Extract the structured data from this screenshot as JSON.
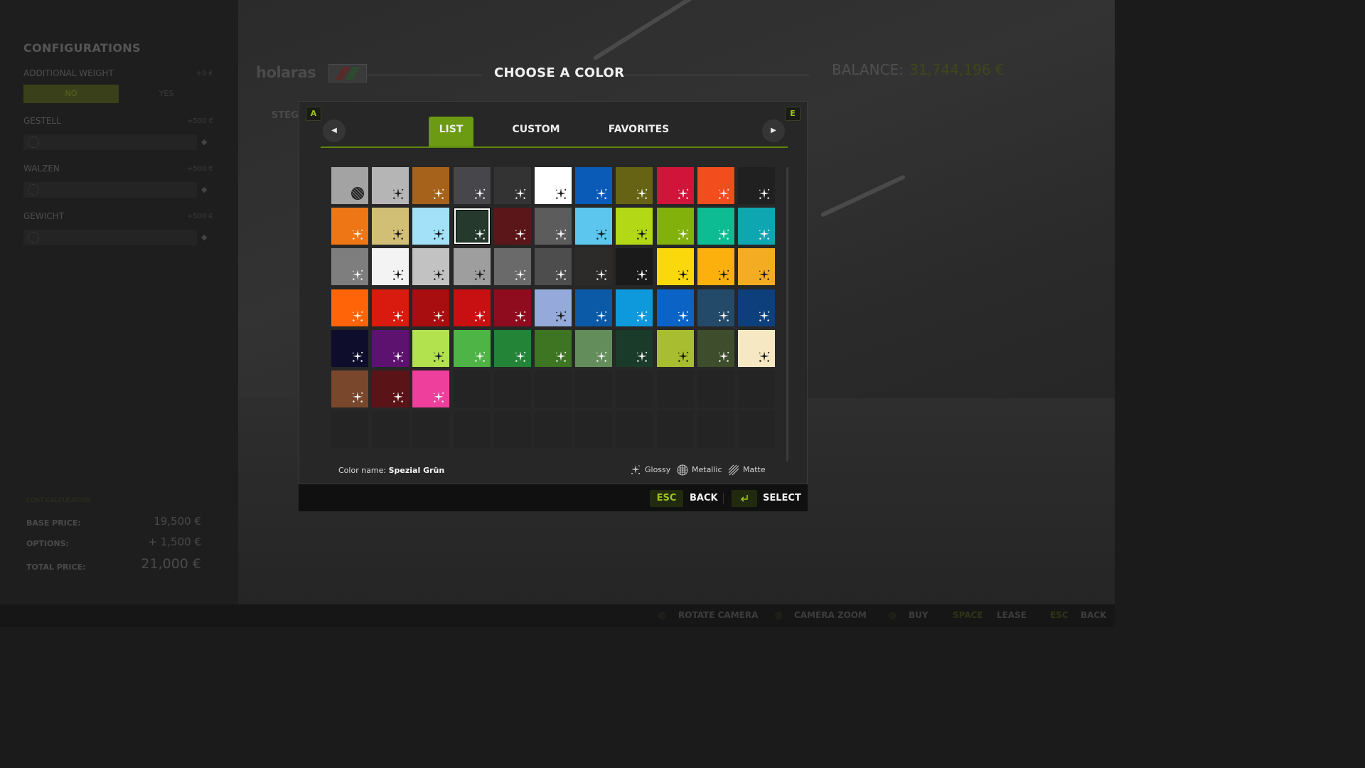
{
  "background": {
    "configurations": {
      "title": "CONFIGURATIONS",
      "additional_weight_label": "ADDITIONAL WEIGHT",
      "additional_weight_price": "+0 €",
      "no_label": "NO",
      "yes_label": "YES",
      "gestell_label": "GESTELL",
      "gestell_price": "+500 €",
      "walzen_label": "WALZEN",
      "walzen_price": "+500 €",
      "gewicht_label": "GEWICHT",
      "gewicht_price": "+500 €"
    },
    "cost": {
      "title": "COST CALCULATION",
      "base_price_label": "BASE PRICE:",
      "base_price": "19,500 €",
      "options_label": "OPTIONS:",
      "options": "+ 1,500 €",
      "total_label": "TOTAL PRICE:",
      "total": "21,000 €"
    },
    "brand": "holaras",
    "steg_label": "STEG",
    "balance_label": "BALANCE:",
    "balance_value": "31,744,196 €",
    "bottom_bar": {
      "rotate_camera": "ROTATE CAMERA",
      "camera_zoom": "CAMERA ZOOM",
      "buy": "BUY",
      "space_key": "SPACE",
      "lease": "LEASE",
      "esc_key": "ESC",
      "back": "BACK"
    }
  },
  "dialog": {
    "title": "CHOOSE A COLOR",
    "key_left": "A",
    "key_right": "E",
    "tabs": [
      {
        "label": "LIST",
        "active": true
      },
      {
        "label": "CUSTOM",
        "active": false
      },
      {
        "label": "FAVORITES",
        "active": false
      }
    ],
    "accent_color": "#6c9a12",
    "swatches": [
      {
        "color": "#a3a3a3",
        "finish": "metallic"
      },
      {
        "color": "#b5b5b5",
        "finish": "glossy"
      },
      {
        "color": "#a6621a",
        "finish": "glossy"
      },
      {
        "color": "#46464b",
        "finish": "glossy"
      },
      {
        "color": "#333333",
        "finish": "glossy"
      },
      {
        "color": "#ffffff",
        "finish": "glossy"
      },
      {
        "color": "#0a5ab8",
        "finish": "glossy"
      },
      {
        "color": "#666414",
        "finish": "glossy"
      },
      {
        "color": "#d0143a",
        "finish": "glossy"
      },
      {
        "color": "#f14d1d",
        "finish": "glossy"
      },
      {
        "color": "#202020",
        "finish": "glossy"
      },
      {
        "color": "#ee7614",
        "finish": "glossy"
      },
      {
        "color": "#d2bf76",
        "finish": "glossy"
      },
      {
        "color": "#a2e1f7",
        "finish": "glossy"
      },
      {
        "color": "#253a2d",
        "finish": "glossy",
        "selected": true
      },
      {
        "color": "#5a1618",
        "finish": "glossy"
      },
      {
        "color": "#5c5c5c",
        "finish": "glossy"
      },
      {
        "color": "#5cc6ef",
        "finish": "glossy"
      },
      {
        "color": "#b2d816",
        "finish": "glossy"
      },
      {
        "color": "#82b10c",
        "finish": "glossy"
      },
      {
        "color": "#0dbc93",
        "finish": "glossy"
      },
      {
        "color": "#0ea7b1",
        "finish": "glossy"
      },
      {
        "color": "#7e7e7e",
        "finish": "glossy"
      },
      {
        "color": "#f3f3f3",
        "finish": "glossy"
      },
      {
        "color": "#c2c2c2",
        "finish": "glossy"
      },
      {
        "color": "#9e9e9e",
        "finish": "glossy"
      },
      {
        "color": "#6a6a6a",
        "finish": "glossy"
      },
      {
        "color": "#4d4d4d",
        "finish": "glossy"
      },
      {
        "color": "#2d2a2a",
        "finish": "glossy"
      },
      {
        "color": "#1a1a1a",
        "finish": "glossy"
      },
      {
        "color": "#fbd80c",
        "finish": "glossy"
      },
      {
        "color": "#fbb00e",
        "finish": "glossy"
      },
      {
        "color": "#f4ac22",
        "finish": "glossy"
      },
      {
        "color": "#ff6408",
        "finish": "glossy"
      },
      {
        "color": "#d91a0f",
        "finish": "glossy"
      },
      {
        "color": "#a80d10",
        "finish": "glossy"
      },
      {
        "color": "#c80f12",
        "finish": "glossy"
      },
      {
        "color": "#8e0c1e",
        "finish": "glossy"
      },
      {
        "color": "#95a9da",
        "finish": "glossy"
      },
      {
        "color": "#0b5aa8",
        "finish": "glossy"
      },
      {
        "color": "#0e99dc",
        "finish": "glossy"
      },
      {
        "color": "#0c63c6",
        "finish": "glossy"
      },
      {
        "color": "#244a6a",
        "finish": "glossy"
      },
      {
        "color": "#0e3f7d",
        "finish": "glossy"
      },
      {
        "color": "#0f0d2c",
        "finish": "glossy"
      },
      {
        "color": "#5d1270",
        "finish": "glossy"
      },
      {
        "color": "#b2e24d",
        "finish": "glossy"
      },
      {
        "color": "#4fb446",
        "finish": "glossy"
      },
      {
        "color": "#238437",
        "finish": "glossy"
      },
      {
        "color": "#3d7522",
        "finish": "glossy"
      },
      {
        "color": "#638e5b",
        "finish": "glossy"
      },
      {
        "color": "#1b3b2a",
        "finish": "glossy"
      },
      {
        "color": "#a8bd2f",
        "finish": "glossy"
      },
      {
        "color": "#3e4d2c",
        "finish": "glossy"
      },
      {
        "color": "#f5e8c3",
        "finish": "glossy"
      },
      {
        "color": "#78472c",
        "finish": "glossy"
      },
      {
        "color": "#5a1418",
        "finish": "glossy"
      },
      {
        "color": "#ef3f9c",
        "finish": "glossy"
      }
    ],
    "total_slots": 77,
    "color_name_label": "Color name:",
    "color_name_value": "Spezial Grün",
    "legend": {
      "glossy": "Glossy",
      "metallic": "Metallic",
      "matte": "Matte"
    },
    "footer": {
      "esc_key": "ESC",
      "back_label": "BACK",
      "select_label": "SELECT"
    }
  }
}
